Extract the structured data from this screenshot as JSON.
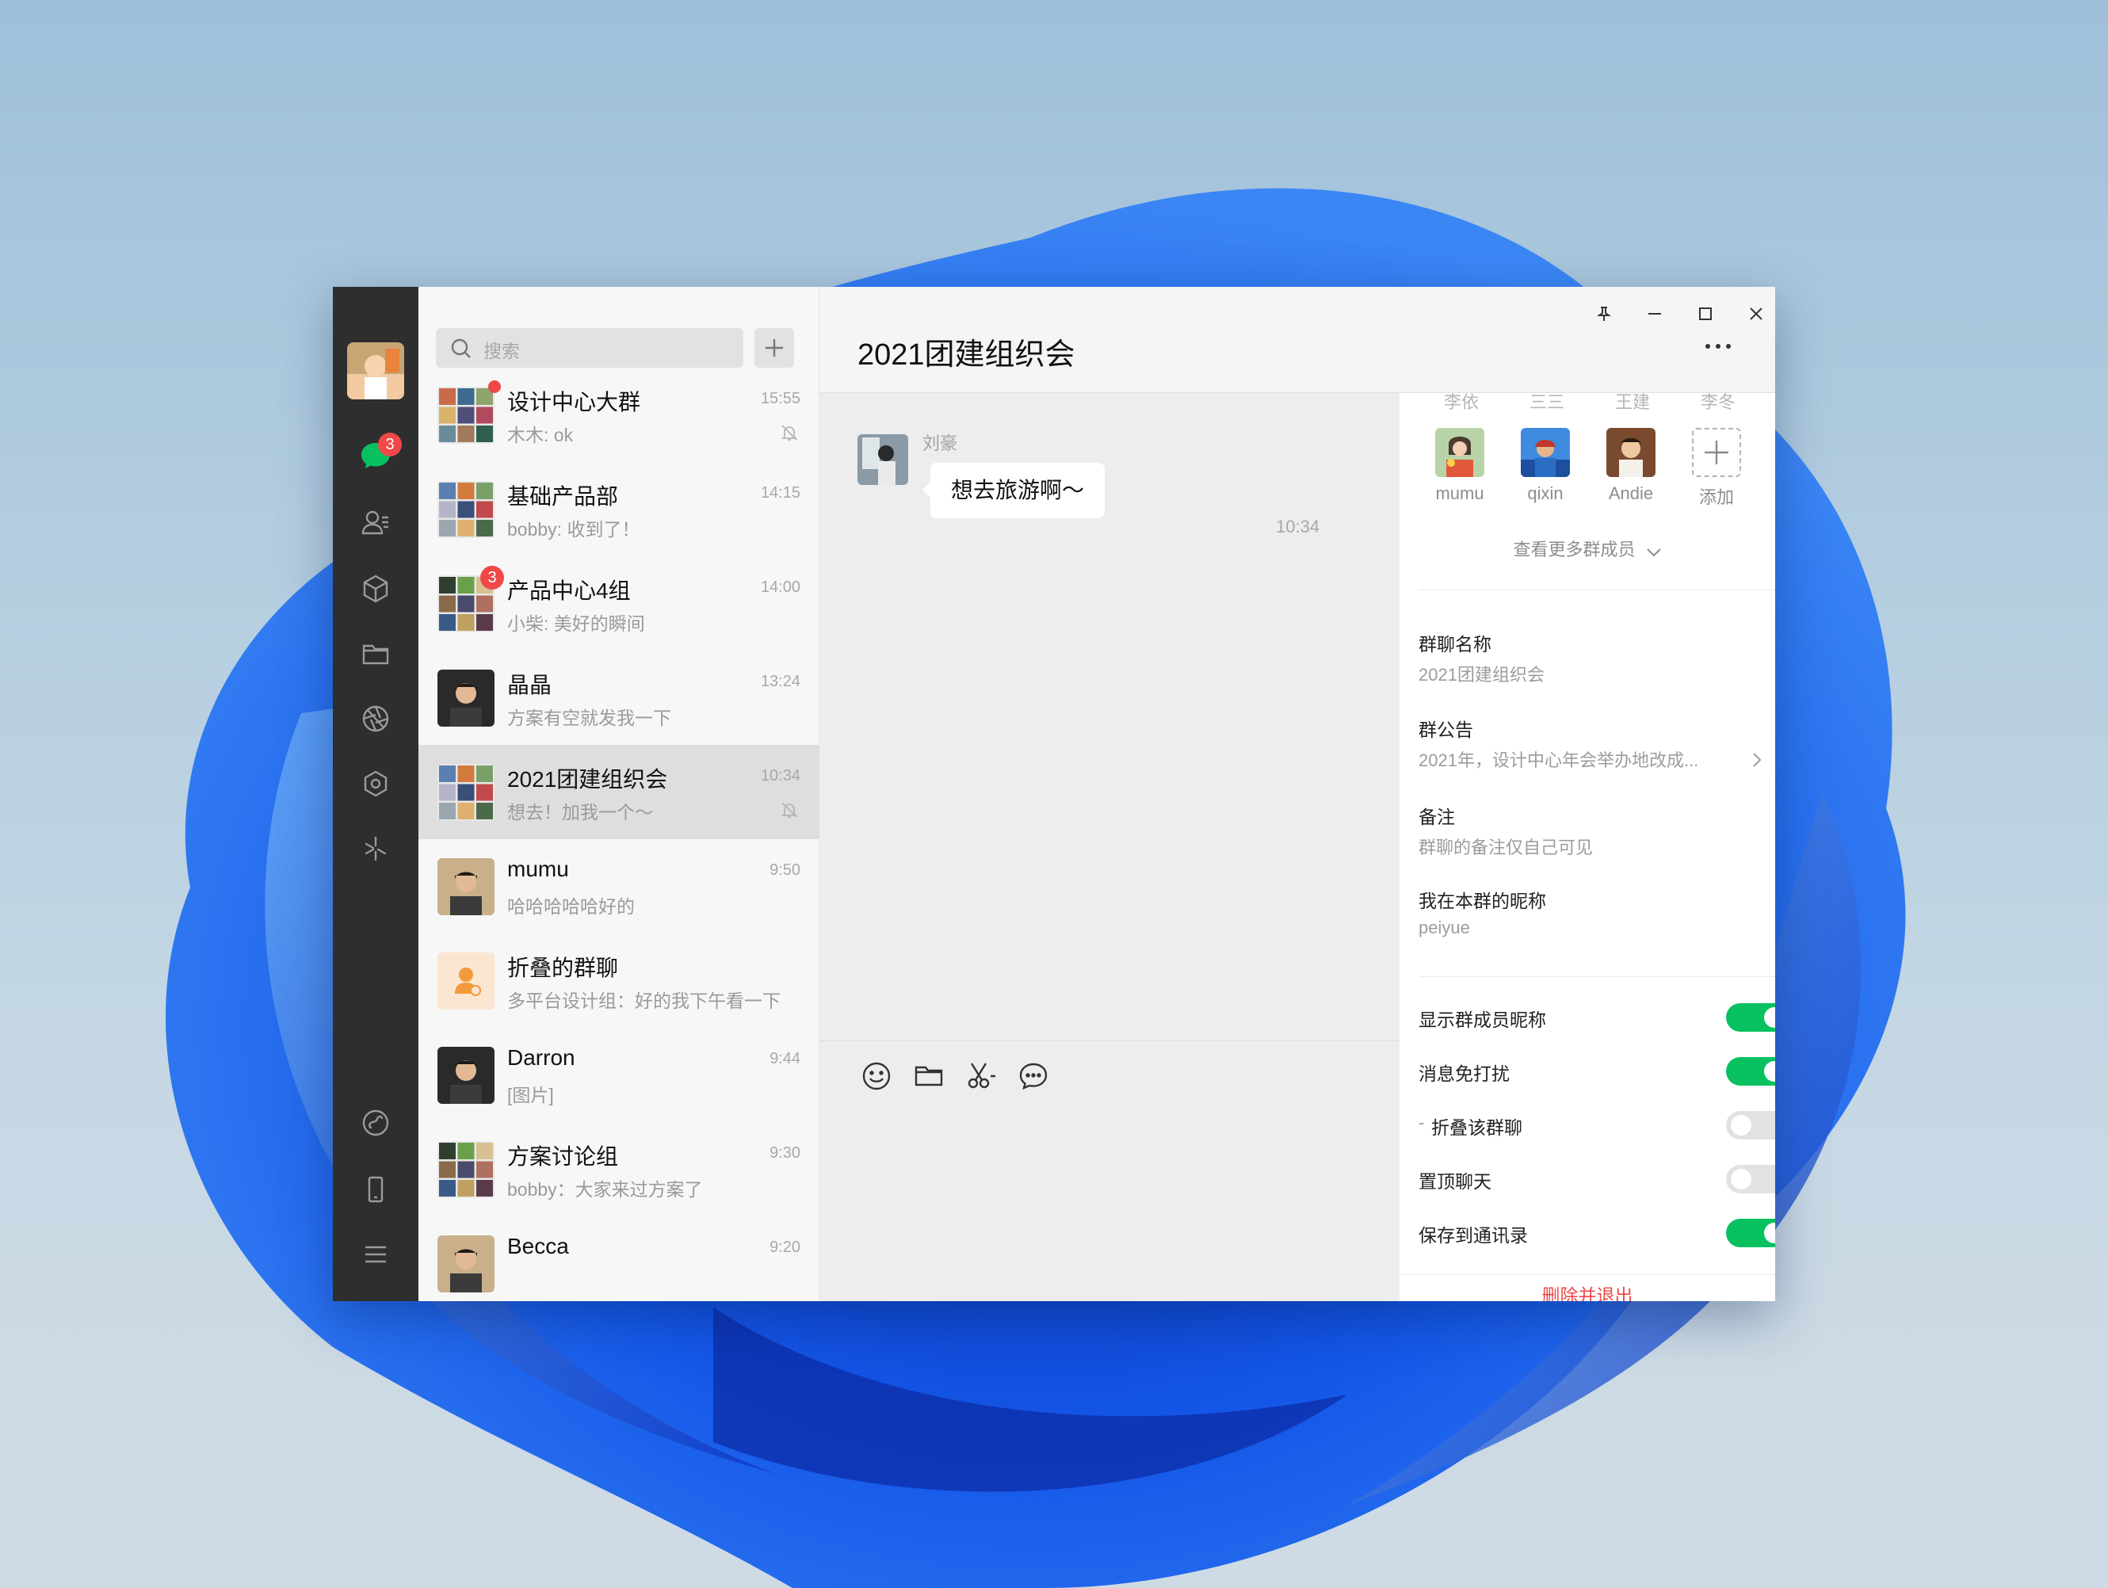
{
  "sidebar": {
    "chat_badge": "3"
  },
  "search": {
    "placeholder": "搜索"
  },
  "chats": [
    {
      "name": "设计中心大群",
      "preview": "木木: ok",
      "time": "15:55",
      "muted": true,
      "dot": true
    },
    {
      "name": "基础产品部",
      "preview": "bobby: 收到了！",
      "time": "14:15"
    },
    {
      "name": "产品中心4组",
      "preview": "小柴: 美好的瞬间",
      "time": "14:00",
      "badge": "3"
    },
    {
      "name": "晶晶",
      "preview": "方案有空就发我一下",
      "time": "13:24"
    },
    {
      "name": "2021团建组织会",
      "preview": "想去！加我一个～",
      "time": "10:34",
      "muted": true,
      "active": true
    },
    {
      "name": "mumu",
      "preview": "哈哈哈哈哈好的",
      "time": "9:50"
    },
    {
      "name": "折叠的群聊",
      "preview": "多平台设计组：好的我下午看一下",
      "time": ""
    },
    {
      "name": "Darron",
      "preview": "[图片]",
      "time": "9:44"
    },
    {
      "name": "方案讨论组",
      "preview": "bobby：大家来过方案了",
      "time": "9:30"
    },
    {
      "name": "Becca",
      "preview": "",
      "time": "9:20"
    }
  ],
  "chat": {
    "title": "2021团建组织会",
    "message": {
      "sender": "刘豪",
      "text": "想去旅游啊～",
      "time": "10:34"
    }
  },
  "panel": {
    "top_row": [
      "李依",
      "三三",
      "王建",
      "李冬"
    ],
    "members": [
      {
        "name": "mumu"
      },
      {
        "name": "qixin"
      },
      {
        "name": "Andie"
      },
      {
        "name": "添加"
      }
    ],
    "more_members": "查看更多群成员",
    "group_name_label": "群聊名称",
    "group_name_value": "2021团建组织会",
    "notice_label": "群公告",
    "notice_value": "2021年，设计中心年会举办地改成...",
    "remark_label": "备注",
    "remark_value": "群聊的备注仅自己可见",
    "nickname_label": "我在本群的昵称",
    "nickname_value": "peiyue",
    "toggles": [
      {
        "label": "显示群成员昵称",
        "on": true
      },
      {
        "label": "消息免打扰",
        "on": true
      },
      {
        "label": "折叠该群聊",
        "on": false
      },
      {
        "label": "置顶聊天",
        "on": false
      },
      {
        "label": "保存到通讯录",
        "on": true
      }
    ],
    "exit_label": "删除并退出"
  },
  "colors": {
    "accent": "#07c160",
    "danger": "#f04848",
    "sidebar": "#2e2e2e"
  }
}
